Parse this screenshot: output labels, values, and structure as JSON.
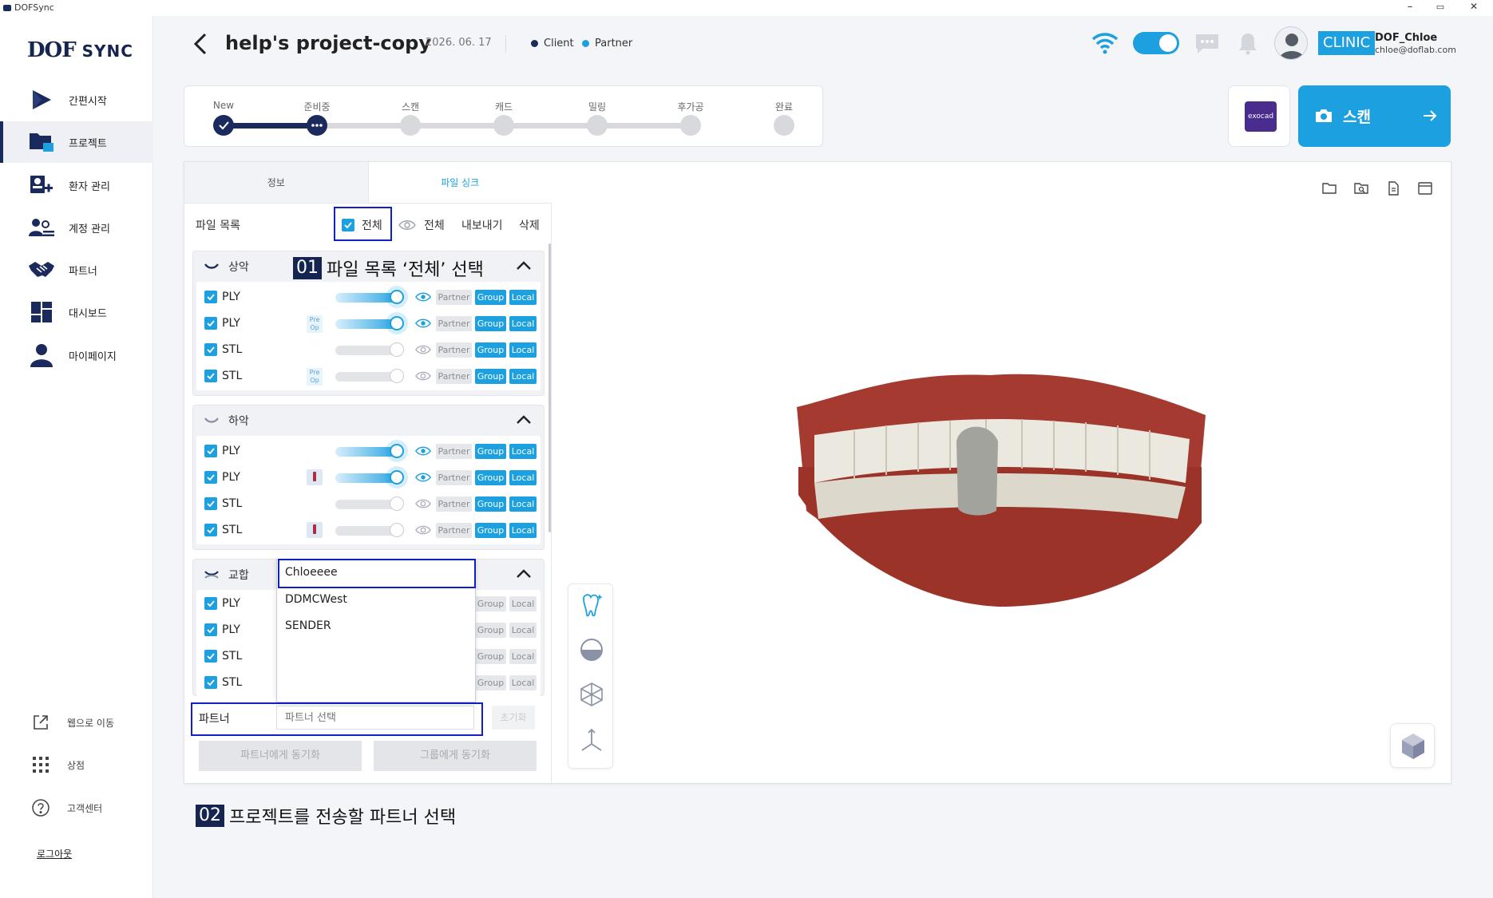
{
  "window": {
    "title": "DOFSync",
    "minimize": "–",
    "maximize": "▭",
    "close": "✕"
  },
  "brand": {
    "logo_left": "DOF",
    "logo_right": "SYNC"
  },
  "sidebar": {
    "items": [
      {
        "label": "간편시작",
        "icon": "play-icon"
      },
      {
        "label": "프로젝트",
        "icon": "folder-icon"
      },
      {
        "label": "환자 관리",
        "icon": "patient-icon"
      },
      {
        "label": "계정 관리",
        "icon": "accounts-icon"
      },
      {
        "label": "파트너",
        "icon": "handshake-icon"
      },
      {
        "label": "대시보드",
        "icon": "dashboard-icon"
      },
      {
        "label": "마이페이지",
        "icon": "user-icon"
      }
    ],
    "bottom": [
      {
        "label": "웹으로 이동",
        "icon": "external-link-icon"
      },
      {
        "label": "상점",
        "icon": "grid-icon"
      },
      {
        "label": "고객센터",
        "icon": "help-icon"
      }
    ],
    "logout": "로그아웃"
  },
  "header": {
    "title": "help's project-copy",
    "date": "2026. 06. 17",
    "legend": [
      {
        "label": "Client",
        "color": "#1b2a5c"
      },
      {
        "label": "Partner",
        "color": "#1da0e0"
      }
    ],
    "badge": "CLINIC",
    "user_name": "DOF_Chloe",
    "user_email": "chloe@doflab.com"
  },
  "progress": {
    "steps": [
      "New",
      "준비중",
      "스캔",
      "캐드",
      "밀링",
      "후가공",
      "완료"
    ],
    "completed": 2
  },
  "actions": {
    "exocad": "exocad",
    "scan": "스캔"
  },
  "tabs": [
    "정보",
    "파일 싱크"
  ],
  "file_list": {
    "label": "파일 목록",
    "select_all": "전체",
    "view_all": "전체",
    "export": "내보내기",
    "delete": "삭제"
  },
  "groups": [
    {
      "name": "상악",
      "files": [
        {
          "type": "PLY",
          "badge": "",
          "on": true,
          "tags": [
            "Partner",
            "Group",
            "Local"
          ],
          "active": [
            false,
            true,
            true
          ]
        },
        {
          "type": "PLY",
          "badge": "Pre Op",
          "on": true,
          "tags": [
            "Partner",
            "Group",
            "Local"
          ],
          "active": [
            false,
            true,
            true
          ]
        },
        {
          "type": "STL",
          "badge": "",
          "on": false,
          "tags": [
            "Partner",
            "Group",
            "Local"
          ],
          "active": [
            false,
            true,
            true
          ]
        },
        {
          "type": "STL",
          "badge": "Pre Op",
          "on": false,
          "tags": [
            "Partner",
            "Group",
            "Local"
          ],
          "active": [
            false,
            true,
            true
          ]
        }
      ]
    },
    {
      "name": "하악",
      "files": [
        {
          "type": "PLY",
          "badge": "",
          "on": true,
          "tags": [
            "Partner",
            "Group",
            "Local"
          ],
          "active": [
            false,
            true,
            true
          ]
        },
        {
          "type": "PLY",
          "badge": "device",
          "on": true,
          "tags": [
            "Partner",
            "Group",
            "Local"
          ],
          "active": [
            false,
            true,
            true
          ]
        },
        {
          "type": "STL",
          "badge": "",
          "on": false,
          "tags": [
            "Partner",
            "Group",
            "Local"
          ],
          "active": [
            false,
            true,
            true
          ]
        },
        {
          "type": "STL",
          "badge": "device",
          "on": false,
          "tags": [
            "Partner",
            "Group",
            "Local"
          ],
          "active": [
            false,
            true,
            true
          ]
        }
      ]
    },
    {
      "name": "교합",
      "files": [
        {
          "type": "PLY",
          "tags": [
            "Group",
            "Local"
          ]
        },
        {
          "type": "PLY",
          "tags": [
            "Group",
            "Local"
          ]
        },
        {
          "type": "STL",
          "tags": [
            "Group",
            "Local"
          ]
        },
        {
          "type": "STL",
          "tags": [
            "Group",
            "Local"
          ]
        }
      ]
    }
  ],
  "dropdown": {
    "options": [
      "Chloeeee",
      "DDMCWest",
      "SENDER"
    ],
    "selected": "Chloeeee"
  },
  "partner": {
    "label": "파트너",
    "placeholder": "파트너 선택",
    "reset": "초기화"
  },
  "sync": {
    "partner": "파트너에게 동기화",
    "group": "그룹에게 동기화"
  },
  "annotations": [
    {
      "num": "01",
      "text": "파일 목록 ‘전체’ 선택"
    },
    {
      "num": "02",
      "text": "프로젝트를 전송할 파트너 선택"
    }
  ]
}
